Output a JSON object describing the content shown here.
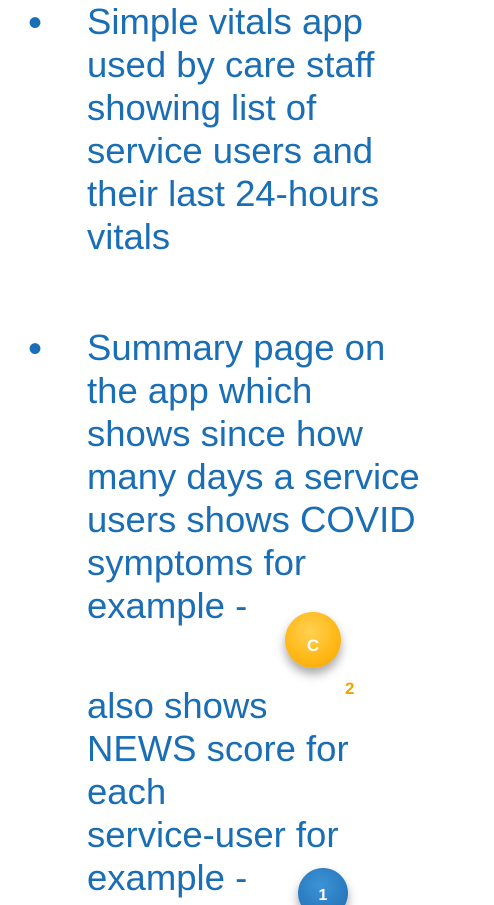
{
  "bullets": [
    {
      "symbol": "•",
      "lines": [
        "Simple vitals app",
        "used by care staff",
        "showing list of",
        "service users and",
        "their last 24-hours",
        "vitals"
      ]
    },
    {
      "symbol": "•",
      "lines": [
        "Summary page on",
        "the app which",
        "shows since how",
        "many days a service",
        "users shows COVID",
        "symptoms for",
        "example -"
      ],
      "continuation_lines": [
        "also shows",
        "NEWS score for",
        "each",
        "service-user for",
        "example -"
      ]
    }
  ],
  "badges": {
    "covid": {
      "label": "C",
      "footnote": "2",
      "color": "#ffb919"
    },
    "news": {
      "label": "1",
      "color": "#2a7bc0"
    }
  },
  "colors": {
    "text": "#1a6eb5",
    "footnote": "#f0a500"
  }
}
